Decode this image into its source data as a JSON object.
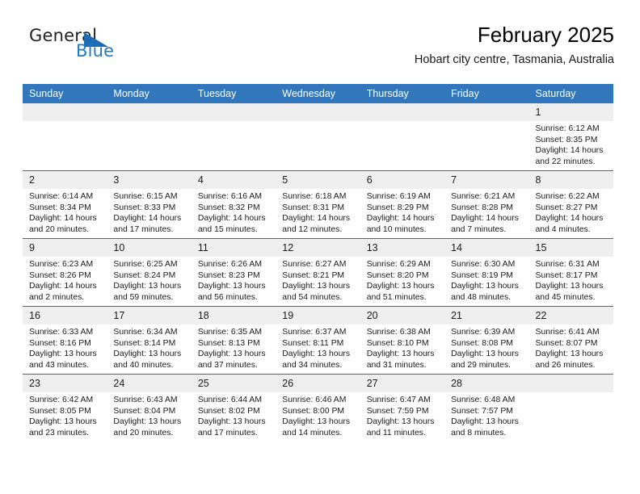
{
  "brand": {
    "name_part1": "General",
    "name_part2": "Blue",
    "logo_icon": "triangle-logo-icon"
  },
  "header": {
    "title": "February 2025",
    "subtitle": "Hobart city centre, Tasmania, Australia"
  },
  "colors": {
    "header_blue": "#3277bb",
    "row_divider_blue": "#2f6fb0",
    "daynum_band": "#efefef",
    "brand_blue": "#1f7ac4"
  },
  "weekdays": [
    "Sunday",
    "Monday",
    "Tuesday",
    "Wednesday",
    "Thursday",
    "Friday",
    "Saturday"
  ],
  "labels": {
    "sunrise": "Sunrise:",
    "sunset": "Sunset:",
    "daylight": "Daylight:"
  },
  "weeks": [
    [
      {
        "day": "",
        "blank": true
      },
      {
        "day": "",
        "blank": true
      },
      {
        "day": "",
        "blank": true
      },
      {
        "day": "",
        "blank": true
      },
      {
        "day": "",
        "blank": true
      },
      {
        "day": "",
        "blank": true
      },
      {
        "day": "1",
        "sunrise": "Sunrise: 6:12 AM",
        "sunset": "Sunset: 8:35 PM",
        "daylight": "Daylight: 14 hours and 22 minutes."
      }
    ],
    [
      {
        "day": "2",
        "sunrise": "Sunrise: 6:14 AM",
        "sunset": "Sunset: 8:34 PM",
        "daylight": "Daylight: 14 hours and 20 minutes."
      },
      {
        "day": "3",
        "sunrise": "Sunrise: 6:15 AM",
        "sunset": "Sunset: 8:33 PM",
        "daylight": "Daylight: 14 hours and 17 minutes."
      },
      {
        "day": "4",
        "sunrise": "Sunrise: 6:16 AM",
        "sunset": "Sunset: 8:32 PM",
        "daylight": "Daylight: 14 hours and 15 minutes."
      },
      {
        "day": "5",
        "sunrise": "Sunrise: 6:18 AM",
        "sunset": "Sunset: 8:31 PM",
        "daylight": "Daylight: 14 hours and 12 minutes."
      },
      {
        "day": "6",
        "sunrise": "Sunrise: 6:19 AM",
        "sunset": "Sunset: 8:29 PM",
        "daylight": "Daylight: 14 hours and 10 minutes."
      },
      {
        "day": "7",
        "sunrise": "Sunrise: 6:21 AM",
        "sunset": "Sunset: 8:28 PM",
        "daylight": "Daylight: 14 hours and 7 minutes."
      },
      {
        "day": "8",
        "sunrise": "Sunrise: 6:22 AM",
        "sunset": "Sunset: 8:27 PM",
        "daylight": "Daylight: 14 hours and 4 minutes."
      }
    ],
    [
      {
        "day": "9",
        "sunrise": "Sunrise: 6:23 AM",
        "sunset": "Sunset: 8:26 PM",
        "daylight": "Daylight: 14 hours and 2 minutes."
      },
      {
        "day": "10",
        "sunrise": "Sunrise: 6:25 AM",
        "sunset": "Sunset: 8:24 PM",
        "daylight": "Daylight: 13 hours and 59 minutes."
      },
      {
        "day": "11",
        "sunrise": "Sunrise: 6:26 AM",
        "sunset": "Sunset: 8:23 PM",
        "daylight": "Daylight: 13 hours and 56 minutes."
      },
      {
        "day": "12",
        "sunrise": "Sunrise: 6:27 AM",
        "sunset": "Sunset: 8:21 PM",
        "daylight": "Daylight: 13 hours and 54 minutes."
      },
      {
        "day": "13",
        "sunrise": "Sunrise: 6:29 AM",
        "sunset": "Sunset: 8:20 PM",
        "daylight": "Daylight: 13 hours and 51 minutes."
      },
      {
        "day": "14",
        "sunrise": "Sunrise: 6:30 AM",
        "sunset": "Sunset: 8:19 PM",
        "daylight": "Daylight: 13 hours and 48 minutes."
      },
      {
        "day": "15",
        "sunrise": "Sunrise: 6:31 AM",
        "sunset": "Sunset: 8:17 PM",
        "daylight": "Daylight: 13 hours and 45 minutes."
      }
    ],
    [
      {
        "day": "16",
        "sunrise": "Sunrise: 6:33 AM",
        "sunset": "Sunset: 8:16 PM",
        "daylight": "Daylight: 13 hours and 43 minutes."
      },
      {
        "day": "17",
        "sunrise": "Sunrise: 6:34 AM",
        "sunset": "Sunset: 8:14 PM",
        "daylight": "Daylight: 13 hours and 40 minutes."
      },
      {
        "day": "18",
        "sunrise": "Sunrise: 6:35 AM",
        "sunset": "Sunset: 8:13 PM",
        "daylight": "Daylight: 13 hours and 37 minutes."
      },
      {
        "day": "19",
        "sunrise": "Sunrise: 6:37 AM",
        "sunset": "Sunset: 8:11 PM",
        "daylight": "Daylight: 13 hours and 34 minutes."
      },
      {
        "day": "20",
        "sunrise": "Sunrise: 6:38 AM",
        "sunset": "Sunset: 8:10 PM",
        "daylight": "Daylight: 13 hours and 31 minutes."
      },
      {
        "day": "21",
        "sunrise": "Sunrise: 6:39 AM",
        "sunset": "Sunset: 8:08 PM",
        "daylight": "Daylight: 13 hours and 29 minutes."
      },
      {
        "day": "22",
        "sunrise": "Sunrise: 6:41 AM",
        "sunset": "Sunset: 8:07 PM",
        "daylight": "Daylight: 13 hours and 26 minutes."
      }
    ],
    [
      {
        "day": "23",
        "sunrise": "Sunrise: 6:42 AM",
        "sunset": "Sunset: 8:05 PM",
        "daylight": "Daylight: 13 hours and 23 minutes."
      },
      {
        "day": "24",
        "sunrise": "Sunrise: 6:43 AM",
        "sunset": "Sunset: 8:04 PM",
        "daylight": "Daylight: 13 hours and 20 minutes."
      },
      {
        "day": "25",
        "sunrise": "Sunrise: 6:44 AM",
        "sunset": "Sunset: 8:02 PM",
        "daylight": "Daylight: 13 hours and 17 minutes."
      },
      {
        "day": "26",
        "sunrise": "Sunrise: 6:46 AM",
        "sunset": "Sunset: 8:00 PM",
        "daylight": "Daylight: 13 hours and 14 minutes."
      },
      {
        "day": "27",
        "sunrise": "Sunrise: 6:47 AM",
        "sunset": "Sunset: 7:59 PM",
        "daylight": "Daylight: 13 hours and 11 minutes."
      },
      {
        "day": "28",
        "sunrise": "Sunrise: 6:48 AM",
        "sunset": "Sunset: 7:57 PM",
        "daylight": "Daylight: 13 hours and 8 minutes."
      },
      {
        "day": "",
        "blank": true
      }
    ]
  ]
}
